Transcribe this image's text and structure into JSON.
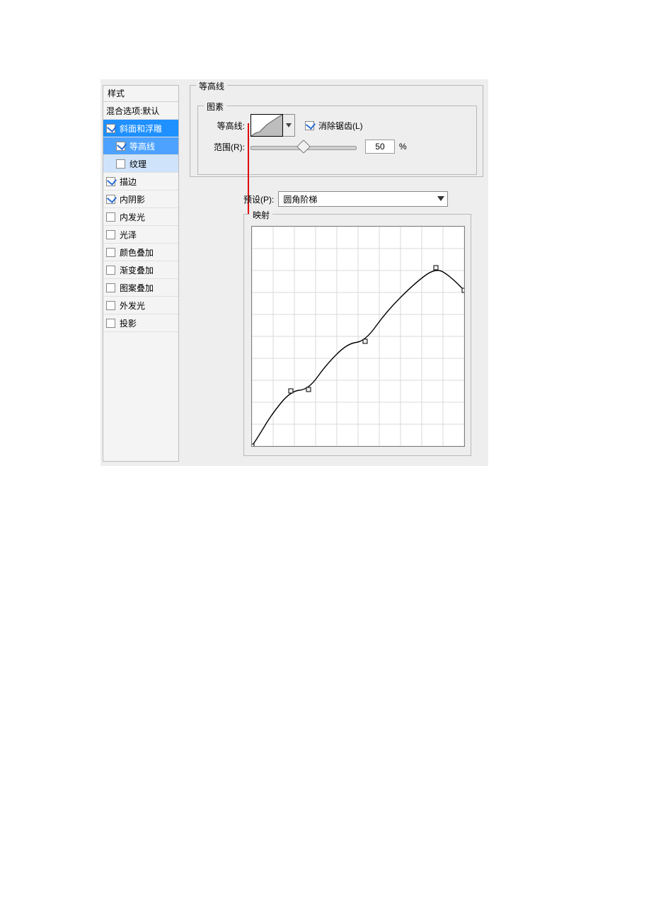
{
  "sidebar": {
    "header": "样式",
    "items": [
      {
        "label": "混合选项:默认",
        "checked": false,
        "has_cb": false
      },
      {
        "label": "斜面和浮雕",
        "checked": true,
        "selected": true,
        "has_cb": true
      },
      {
        "label": "等高线",
        "checked": true,
        "sub": true,
        "sub_selected": true,
        "has_cb": true
      },
      {
        "label": "纹理",
        "checked": false,
        "sub": true,
        "has_cb": true
      },
      {
        "label": "描边",
        "checked": true,
        "has_cb": true
      },
      {
        "label": "内阴影",
        "checked": true,
        "has_cb": true
      },
      {
        "label": "内发光",
        "checked": false,
        "has_cb": true
      },
      {
        "label": "光泽",
        "checked": false,
        "has_cb": true
      },
      {
        "label": "颜色叠加",
        "checked": false,
        "has_cb": true
      },
      {
        "label": "渐变叠加",
        "checked": false,
        "has_cb": true
      },
      {
        "label": "图案叠加",
        "checked": false,
        "has_cb": true
      },
      {
        "label": "外发光",
        "checked": false,
        "has_cb": true
      },
      {
        "label": "投影",
        "checked": false,
        "has_cb": true
      }
    ]
  },
  "group_outer_title": "等高线",
  "group_inner_title": "图素",
  "contour_label": "等高线:",
  "antialias_label": "消除锯齿(L)",
  "antialias_checked": true,
  "range_label": "范围(R):",
  "range_value": "50",
  "range_unit": "%",
  "range_percent": 50,
  "preset_label": "预设(P):",
  "preset_value": "圆角阶梯",
  "map_title": "映射",
  "chart_data": {
    "type": "line",
    "title": "映射",
    "xlabel": "",
    "ylabel": "",
    "xlim": [
      0,
      300
    ],
    "ylim": [
      0,
      310
    ],
    "grid": "on",
    "points": [
      {
        "x": 0,
        "y": 310
      },
      {
        "x": 10,
        "y": 295
      },
      {
        "x": 28,
        "y": 265
      },
      {
        "x": 55,
        "y": 232
      },
      {
        "x": 80,
        "y": 230
      },
      {
        "x": 105,
        "y": 195
      },
      {
        "x": 135,
        "y": 165
      },
      {
        "x": 160,
        "y": 162
      },
      {
        "x": 190,
        "y": 120
      },
      {
        "x": 230,
        "y": 80
      },
      {
        "x": 260,
        "y": 58
      },
      {
        "x": 280,
        "y": 70
      },
      {
        "x": 300,
        "y": 90
      }
    ],
    "anchor_indices": [
      0,
      3,
      4,
      7,
      10,
      12
    ]
  }
}
